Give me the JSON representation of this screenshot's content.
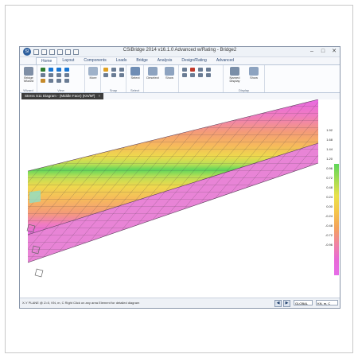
{
  "window": {
    "title": "CSiBridge 2014 v16.1.0 Advanced w/Rating - Bridge2",
    "controls": [
      "–",
      "□",
      "✕"
    ]
  },
  "ribbon": {
    "tabs": [
      "Home",
      "Layout",
      "Components",
      "Loads",
      "Bridge",
      "Analysis",
      "Design/Rating",
      "Advanced"
    ],
    "active_tab": "Home",
    "groups": [
      {
        "label": "Wizard",
        "buttons": [
          "Bridge Wizard"
        ]
      },
      {
        "label": "View",
        "buttons": []
      },
      {
        "label": "",
        "buttons": [
          "More"
        ]
      },
      {
        "label": "Snap",
        "buttons": []
      },
      {
        "label": "Select",
        "buttons": [
          "Select"
        ]
      },
      {
        "label": "",
        "buttons": [
          "Deselect",
          "Show"
        ]
      },
      {
        "label": "Display",
        "buttons": [
          "Named Display",
          "Show"
        ]
      }
    ]
  },
  "document_tab": {
    "label": "Stress S11 Diagram - (Middle Face) (KN/M²)"
  },
  "legend": {
    "values": [
      "1.92",
      "1.68",
      "1.44",
      "1.20",
      "0.96",
      "0.72",
      "0.48",
      "0.24",
      "0.00",
      "-0.24",
      "-0.48",
      "-0.72",
      "-0.96"
    ]
  },
  "status": {
    "text": "X-Y PLANE @ Z=0, KN, m, C   Right Click on any area Element for detailed diagram",
    "zoom_value": "GLOBAL",
    "units_value": "KN, m, C"
  },
  "colors": {
    "ribbon_accent": "#2f4c78",
    "deck_stripes": [
      "#e868e4",
      "#f07cc0",
      "#f49b78",
      "#f6b95c",
      "#eed94d",
      "#b8df55",
      "#5fd65a"
    ]
  }
}
